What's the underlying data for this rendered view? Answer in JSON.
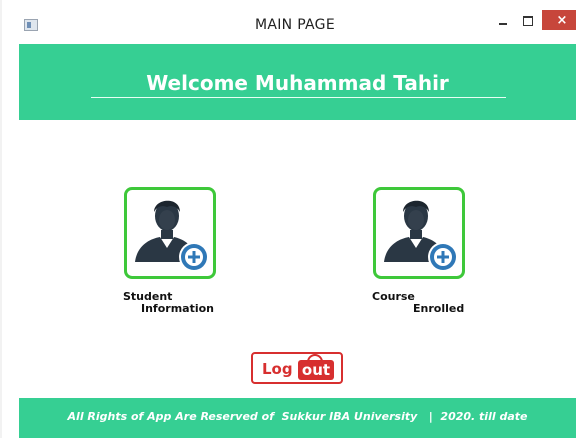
{
  "window": {
    "title": "MAIN PAGE",
    "controls": {
      "minimize_icon": "minimize-icon",
      "maximize_icon": "maximize-icon",
      "close_icon": "close-icon",
      "close_glyph": "×"
    }
  },
  "header": {
    "welcome": "Welcome Muhammad Tahir"
  },
  "cards": [
    {
      "id": "student",
      "line1": "Student",
      "line2": "Information",
      "icon": "user-add-icon"
    },
    {
      "id": "course",
      "line1": "Course",
      "line2": "Enrolled",
      "icon": "user-add-icon"
    }
  ],
  "logout": {
    "log": "Log",
    "out": "out"
  },
  "footer": {
    "text": "All Rights of App Are Reserved of  Sukkur IBA University   |  2020. till date"
  },
  "colors": {
    "accent_green": "#36cf93",
    "card_border": "#3ec83a",
    "logout_red": "#d72f2f",
    "close_red": "#c7463b",
    "avatar_dark": "#2a3744",
    "plus_blue": "#2f78b7"
  }
}
